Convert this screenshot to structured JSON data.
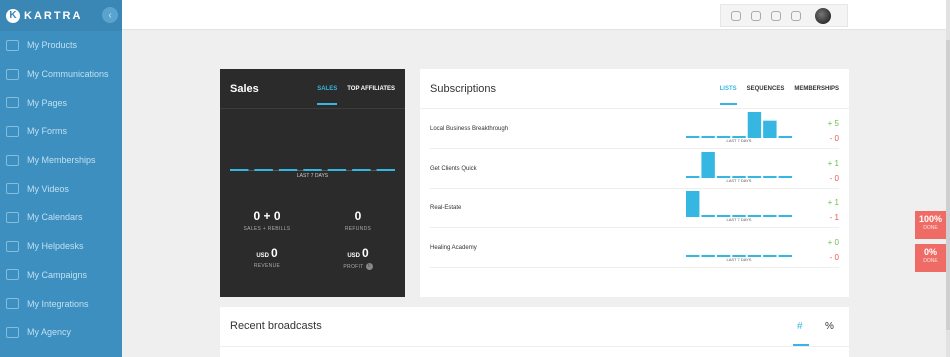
{
  "brand": {
    "name": "KARTRA"
  },
  "sidebar": {
    "items": [
      {
        "label": "My Products",
        "icon": "cart-icon"
      },
      {
        "label": "My Communications",
        "icon": "megaphone-icon"
      },
      {
        "label": "My Pages",
        "icon": "pages-icon"
      },
      {
        "label": "My Forms",
        "icon": "forms-icon"
      },
      {
        "label": "My Memberships",
        "icon": "memberships-icon"
      },
      {
        "label": "My Videos",
        "icon": "video-icon"
      },
      {
        "label": "My Calendars",
        "icon": "calendar-icon"
      },
      {
        "label": "My Helpdesks",
        "icon": "headset-icon"
      },
      {
        "label": "My Campaigns",
        "icon": "campaign-icon"
      },
      {
        "label": "My Integrations",
        "icon": "integrations-icon"
      },
      {
        "label": "My Agency",
        "icon": "agency-icon"
      }
    ]
  },
  "topbar": {
    "icons": [
      "home-icon",
      "crosshair-icon",
      "bell-icon",
      "flag-icon"
    ]
  },
  "sales": {
    "title": "Sales",
    "tabs": [
      "SALES",
      "TOP AFFILIATES"
    ],
    "chart_label": "LAST 7 DAYS",
    "chart_values": [
      0,
      0,
      0,
      0,
      0,
      0,
      0
    ],
    "stats": {
      "sales_val": "0 + 0",
      "sales_lbl": "SALES + REBILLS",
      "refunds_val": "0",
      "refunds_lbl": "REFUNDS",
      "revenue_cur": "USD",
      "revenue_val": "0",
      "revenue_lbl": "REVENUE",
      "profit_cur": "USD",
      "profit_val": "0",
      "profit_lbl": "PROFIT",
      "profit_info": "i"
    }
  },
  "subscriptions": {
    "title": "Subscriptions",
    "tabs": [
      "LISTS",
      "SEQUENCES",
      "MEMBERSHIPS"
    ],
    "chart_label": "LAST 7 DAYS",
    "rows": [
      {
        "name": "Local Business Breakthrough",
        "plus": "+ 5",
        "minus": "- 0",
        "values": [
          0,
          0,
          0,
          0,
          3,
          2,
          0
        ]
      },
      {
        "name": "Get Clients Quick",
        "plus": "+ 1",
        "minus": "- 0",
        "values": [
          0,
          1,
          0,
          0,
          0,
          0,
          0
        ]
      },
      {
        "name": "Real-Estate",
        "plus": "+ 1",
        "minus": "- 1",
        "values": [
          1,
          0,
          0,
          0,
          0,
          0,
          0
        ]
      },
      {
        "name": "Healing Academy",
        "plus": "+ 0",
        "minus": "- 0",
        "values": [
          0,
          0,
          0,
          0,
          0,
          0,
          0
        ]
      }
    ]
  },
  "broadcasts": {
    "title": "Recent broadcasts",
    "tab_count": "#",
    "tab_percent": "%"
  },
  "badges": [
    {
      "value": "100%",
      "label": "DONE"
    },
    {
      "value": "0%",
      "label": "DONE"
    }
  ],
  "colors": {
    "sidebar": "#3d8fbf",
    "accent": "#36b7e2",
    "dark_card": "#2b2b2b",
    "positive": "#6bbf4e",
    "negative": "#e45a4f",
    "badge": "#ef6b66"
  }
}
